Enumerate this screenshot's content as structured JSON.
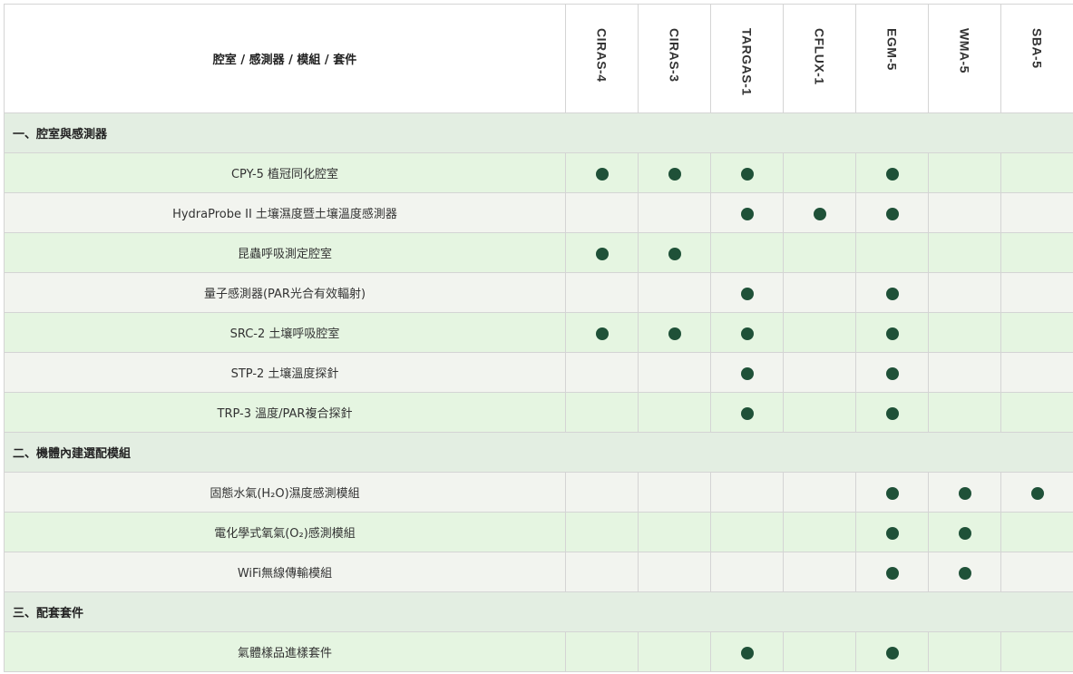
{
  "header": {
    "title": "腔室 / 感測器 / 模組 / 套件",
    "products": [
      "CIRAS-4",
      "CIRAS-3",
      "TARGAS-1",
      "CFLUX-1",
      "EGM-5",
      "WMA-5",
      "SBA-5"
    ]
  },
  "colors": {
    "dot": "#1f5138",
    "section_bg": "#e3eee2",
    "row_green": "#e5f5e1",
    "row_gray": "#f2f4ef"
  },
  "sections": [
    {
      "title": "一、腔室與感測器",
      "rows": [
        {
          "name": "CPY-5 植冠同化腔室",
          "marks": [
            1,
            1,
            1,
            0,
            1,
            0,
            0
          ]
        },
        {
          "name": "HydraProbe II 土壤濕度暨土壤溫度感測器",
          "marks": [
            0,
            0,
            1,
            1,
            1,
            0,
            0
          ]
        },
        {
          "name": "昆蟲呼吸測定腔室",
          "marks": [
            1,
            1,
            0,
            0,
            0,
            0,
            0
          ]
        },
        {
          "name": "量子感測器(PAR光合有效輻射)",
          "marks": [
            0,
            0,
            1,
            0,
            1,
            0,
            0
          ]
        },
        {
          "name": "SRC-2 土壤呼吸腔室",
          "marks": [
            1,
            1,
            1,
            0,
            1,
            0,
            0
          ]
        },
        {
          "name": "STP-2 土壤溫度探針",
          "marks": [
            0,
            0,
            1,
            0,
            1,
            0,
            0
          ]
        },
        {
          "name": "TRP-3 溫度/PAR複合探針",
          "marks": [
            0,
            0,
            1,
            0,
            1,
            0,
            0
          ]
        }
      ]
    },
    {
      "title": "二、機體內建選配模組",
      "rows": [
        {
          "name": "固態水氣(H₂O)濕度感測模組",
          "marks": [
            0,
            0,
            0,
            0,
            1,
            1,
            1
          ]
        },
        {
          "name": "電化學式氧氣(O₂)感測模組",
          "marks": [
            0,
            0,
            0,
            0,
            1,
            1,
            0
          ]
        },
        {
          "name": "WiFi無線傳輸模組",
          "marks": [
            0,
            0,
            0,
            0,
            1,
            1,
            0
          ]
        }
      ]
    },
    {
      "title": "三、配套套件",
      "rows": [
        {
          "name": "氣體樣品進樣套件",
          "marks": [
            0,
            0,
            1,
            0,
            1,
            0,
            0
          ]
        }
      ]
    }
  ]
}
